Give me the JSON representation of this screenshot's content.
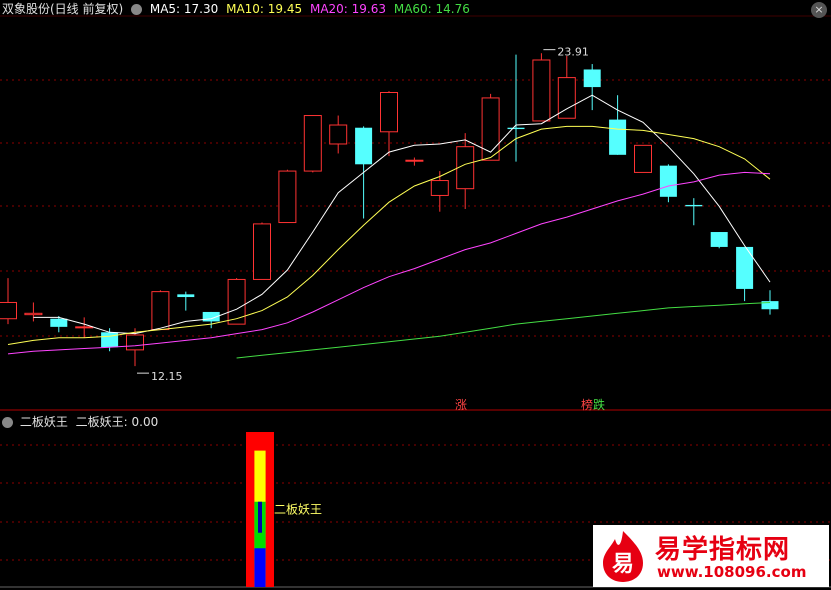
{
  "header": {
    "title": "双象股份(日线 前复权)",
    "ma5": "MA5: 17.30",
    "ma10": "MA10: 19.45",
    "ma20": "MA20: 19.63",
    "ma60": "MA60: 14.76",
    "close_icon": "close-icon",
    "colors": {
      "title": "#e0e0e0",
      "ma5": "#ffffff",
      "ma10": "#ffff55",
      "ma20": "#ff44ff",
      "ma60": "#44dd44"
    }
  },
  "indicator_header": {
    "name": "二板妖王",
    "value": "二板妖王: 0.00"
  },
  "chart_data": [
    {
      "type": "candlestick",
      "title": "双象股份(日线 前复权)",
      "ylim": [
        11.2,
        25.3
      ],
      "candles": [
        {
          "o": 14.2,
          "c": 14.8,
          "h": 15.7,
          "l": 14.0
        },
        {
          "o": 14.35,
          "c": 14.4,
          "h": 14.8,
          "l": 14.1
        },
        {
          "o": 14.2,
          "c": 13.9,
          "h": 14.3,
          "l": 13.7
        },
        {
          "o": 13.9,
          "c": 13.9,
          "h": 14.25,
          "l": 13.5
        },
        {
          "o": 13.7,
          "c": 13.15,
          "h": 13.85,
          "l": 13.0
        },
        {
          "o": 13.05,
          "c": 13.6,
          "h": 13.85,
          "l": 12.45
        },
        {
          "o": 13.8,
          "c": 15.2,
          "h": 15.25,
          "l": 13.8
        },
        {
          "o": 15.1,
          "c": 15.0,
          "h": 15.2,
          "l": 14.5
        },
        {
          "o": 14.45,
          "c": 14.1,
          "h": 14.45,
          "l": 13.85
        },
        {
          "o": 14.0,
          "c": 15.65,
          "h": 15.7,
          "l": 14.0
        },
        {
          "o": 15.65,
          "c": 17.7,
          "h": 17.75,
          "l": 15.65
        },
        {
          "o": 17.75,
          "c": 19.65,
          "h": 19.7,
          "l": 17.75
        },
        {
          "o": 19.65,
          "c": 21.7,
          "h": 21.7,
          "l": 19.6
        },
        {
          "o": 20.65,
          "c": 21.35,
          "h": 21.7,
          "l": 20.3
        },
        {
          "o": 21.25,
          "c": 19.9,
          "h": 21.3,
          "l": 17.9
        },
        {
          "o": 21.1,
          "c": 22.55,
          "h": 22.6,
          "l": 20.2
        },
        {
          "o": 20.05,
          "c": 20.05,
          "h": 20.15,
          "l": 19.85
        },
        {
          "o": 18.75,
          "c": 19.3,
          "h": 19.65,
          "l": 18.15
        },
        {
          "o": 19.0,
          "c": 20.55,
          "h": 21.05,
          "l": 18.25
        },
        {
          "o": 20.05,
          "c": 22.35,
          "h": 22.5,
          "l": 20.05
        },
        {
          "o": 21.25,
          "c": 21.2,
          "h": 23.95,
          "l": 20.0
        },
        {
          "o": 21.5,
          "c": 23.75,
          "h": 24.0,
          "l": 21.5
        },
        {
          "o": 21.6,
          "c": 23.1,
          "h": 23.9,
          "l": 21.6
        },
        {
          "o": 23.4,
          "c": 22.75,
          "h": 23.6,
          "l": 21.9
        },
        {
          "o": 21.55,
          "c": 20.25,
          "h": 22.45,
          "l": 20.25
        },
        {
          "o": 19.6,
          "c": 20.6,
          "h": 20.6,
          "l": 19.6
        },
        {
          "o": 19.85,
          "c": 18.7,
          "h": 19.9,
          "l": 18.5
        },
        {
          "o": 18.4,
          "c": 18.35,
          "h": 18.65,
          "l": 17.65
        },
        {
          "o": 17.4,
          "c": 16.85,
          "h": 17.4,
          "l": 16.8
        },
        {
          "o": 16.85,
          "c": 15.3,
          "h": 16.85,
          "l": 14.85
        },
        {
          "o": 14.85,
          "c": 14.55,
          "h": 15.25,
          "l": 14.35
        }
      ],
      "series": [
        {
          "name": "MA5",
          "color": "#ffffff",
          "values": [
            null,
            14.25,
            14.25,
            14.0,
            13.7,
            13.65,
            13.85,
            14.1,
            14.2,
            14.55,
            15.1,
            16.0,
            17.4,
            18.85,
            19.6,
            20.35,
            20.6,
            20.65,
            20.8,
            20.35,
            21.35,
            21.4,
            21.95,
            22.45,
            21.9,
            21.45,
            20.55,
            19.55,
            18.35,
            16.9,
            15.55
          ]
        },
        {
          "name": "MA10",
          "color": "#ffff55",
          "values": [
            13.25,
            13.4,
            13.5,
            13.5,
            13.55,
            13.7,
            13.8,
            13.9,
            14.0,
            14.2,
            14.5,
            15.0,
            15.8,
            16.75,
            17.65,
            18.5,
            19.1,
            19.45,
            19.9,
            20.15,
            20.85,
            21.2,
            21.3,
            21.3,
            21.2,
            21.15,
            21.0,
            20.85,
            20.55,
            20.1,
            19.35
          ]
        },
        {
          "name": "MA20",
          "color": "#ff44ff",
          "values": [
            12.9,
            13.0,
            13.05,
            13.1,
            13.15,
            13.2,
            13.3,
            13.4,
            13.5,
            13.65,
            13.8,
            14.05,
            14.45,
            14.9,
            15.35,
            15.75,
            16.05,
            16.4,
            16.75,
            17.0,
            17.35,
            17.7,
            17.95,
            18.25,
            18.55,
            18.8,
            19.1,
            19.25,
            19.5,
            19.6,
            19.55
          ]
        },
        {
          "name": "MA60",
          "color": "#44dd44",
          "values": [
            null,
            null,
            null,
            null,
            null,
            null,
            null,
            null,
            null,
            12.75,
            12.85,
            12.95,
            13.05,
            13.15,
            13.25,
            13.35,
            13.45,
            13.55,
            13.7,
            13.85,
            14.0,
            14.1,
            14.2,
            14.3,
            14.4,
            14.5,
            14.6,
            14.65,
            14.7,
            14.75,
            14.8
          ]
        }
      ],
      "annotations": [
        {
          "text": "23.91",
          "index": 21,
          "value": 23.91
        },
        {
          "text": "12.15",
          "index": 5,
          "value": 12.45
        }
      ],
      "markers": [
        {
          "text": "涨",
          "index": 17,
          "color": "#ff4444"
        },
        {
          "text": "榜",
          "index": 22,
          "color": "#ff4444"
        },
        {
          "text": "跌",
          "index": 23,
          "color": "#44dd44"
        }
      ],
      "up_color": "#ff3333",
      "down_color": "#55ffff"
    },
    {
      "type": "bar",
      "title": "二板妖王",
      "signal_index": 10,
      "label": "二板妖王",
      "ylim": [
        0,
        1
      ],
      "layers": [
        {
          "name": "red",
          "color": "#ff0000",
          "top": 1.0,
          "bottom": 0.0,
          "width": 1.0
        },
        {
          "name": "yellow",
          "color": "#ffff00",
          "top": 0.88,
          "bottom": 0.0,
          "width": 0.4
        },
        {
          "name": "green",
          "color": "#00dd00",
          "top": 0.55,
          "bottom": 0.15,
          "width": 0.4
        },
        {
          "name": "blue",
          "color": "#0000ff",
          "top": 0.25,
          "bottom": 0.0,
          "width": 0.4
        }
      ]
    }
  ],
  "watermark": {
    "logo_char": "易",
    "title": "易学指标网",
    "url": "www.108096.com"
  }
}
